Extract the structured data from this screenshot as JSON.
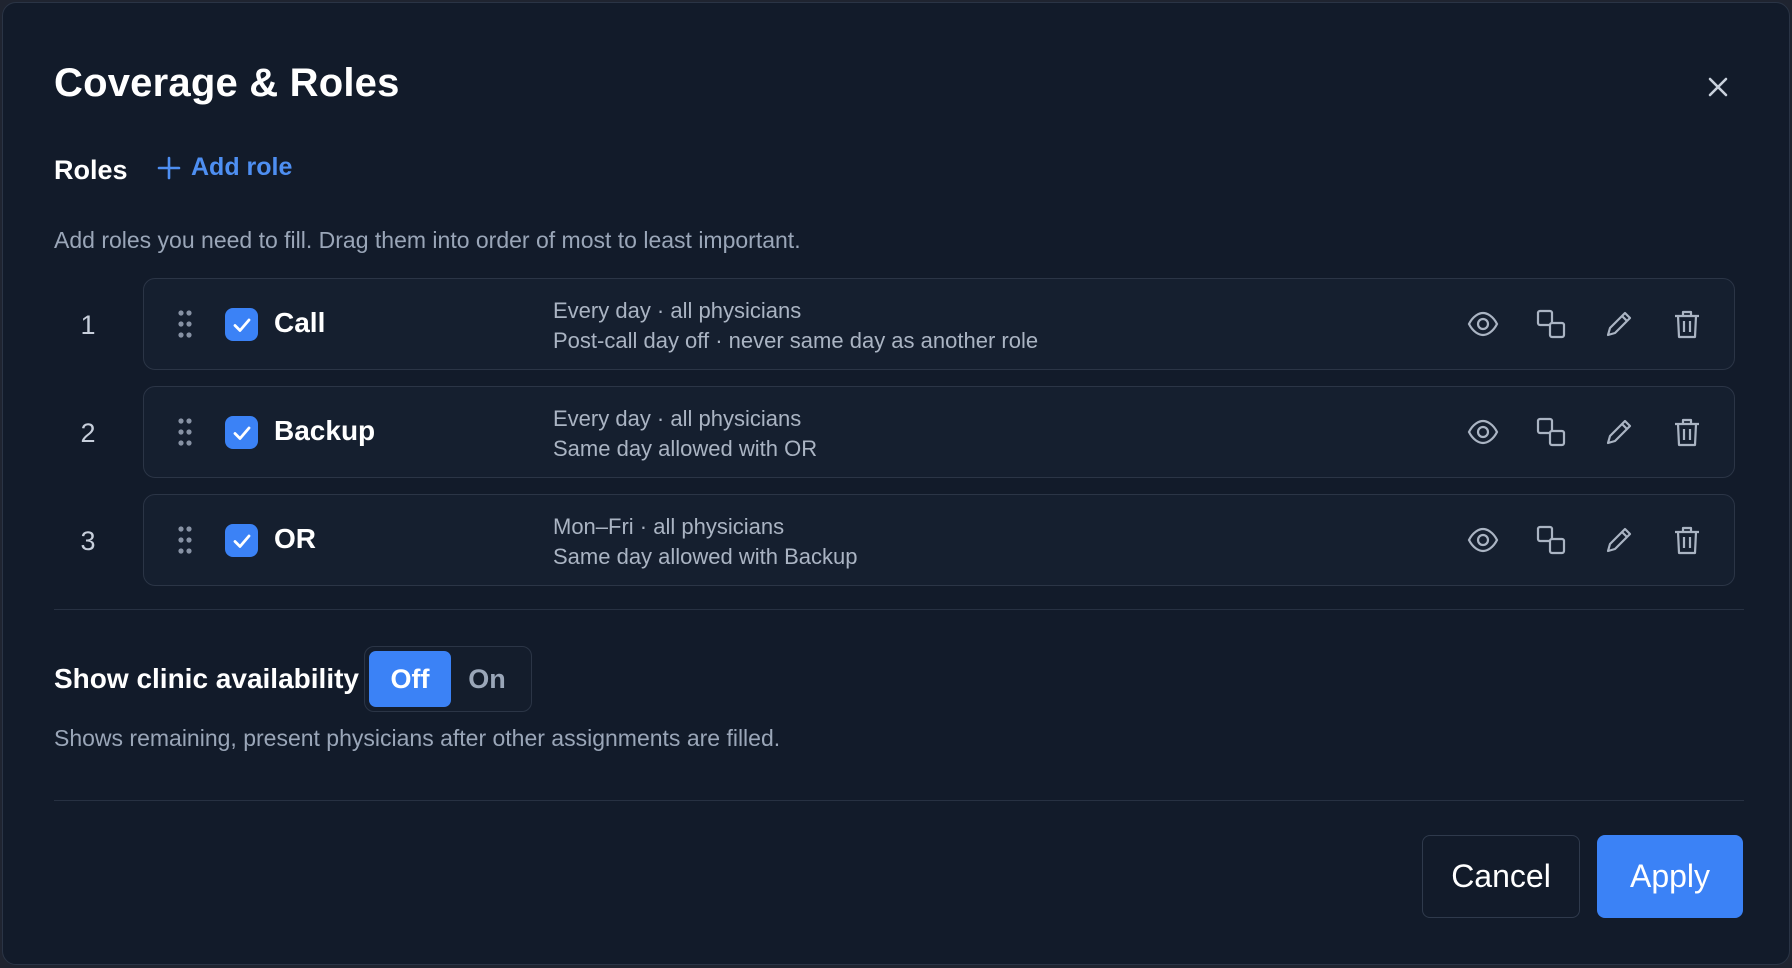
{
  "dialog": {
    "title": "Coverage & Roles",
    "close_icon": "close-icon"
  },
  "roles_section": {
    "label": "Roles",
    "add_role_label": "Add role",
    "hint": "Add roles you need to fill. Drag them into order of most to least important."
  },
  "roles": [
    {
      "number": "1",
      "name": "Call",
      "checked": true,
      "desc_line1": "Every day · all physicians",
      "desc_line2": "Post-call day off · never same day as another role"
    },
    {
      "number": "2",
      "name": "Backup",
      "checked": true,
      "desc_line1": "Every day · all physicians",
      "desc_line2": "Same day allowed with OR"
    },
    {
      "number": "3",
      "name": "OR",
      "checked": true,
      "desc_line1": "Mon–Fri · all physicians",
      "desc_line2": "Same day allowed with Backup"
    }
  ],
  "role_actions": [
    "eye-icon",
    "copy-icon",
    "pencil-icon",
    "trash-icon"
  ],
  "clinic": {
    "label": "Show clinic availability",
    "options": [
      "Off",
      "On"
    ],
    "selected": "Off",
    "hint": "Shows remaining, present physicians after other assignments are filled."
  },
  "footer": {
    "cancel_label": "Cancel",
    "apply_label": "Apply"
  },
  "colors": {
    "background": "#121b2a",
    "accent": "#3b82f6",
    "link": "#4e8ff2"
  }
}
